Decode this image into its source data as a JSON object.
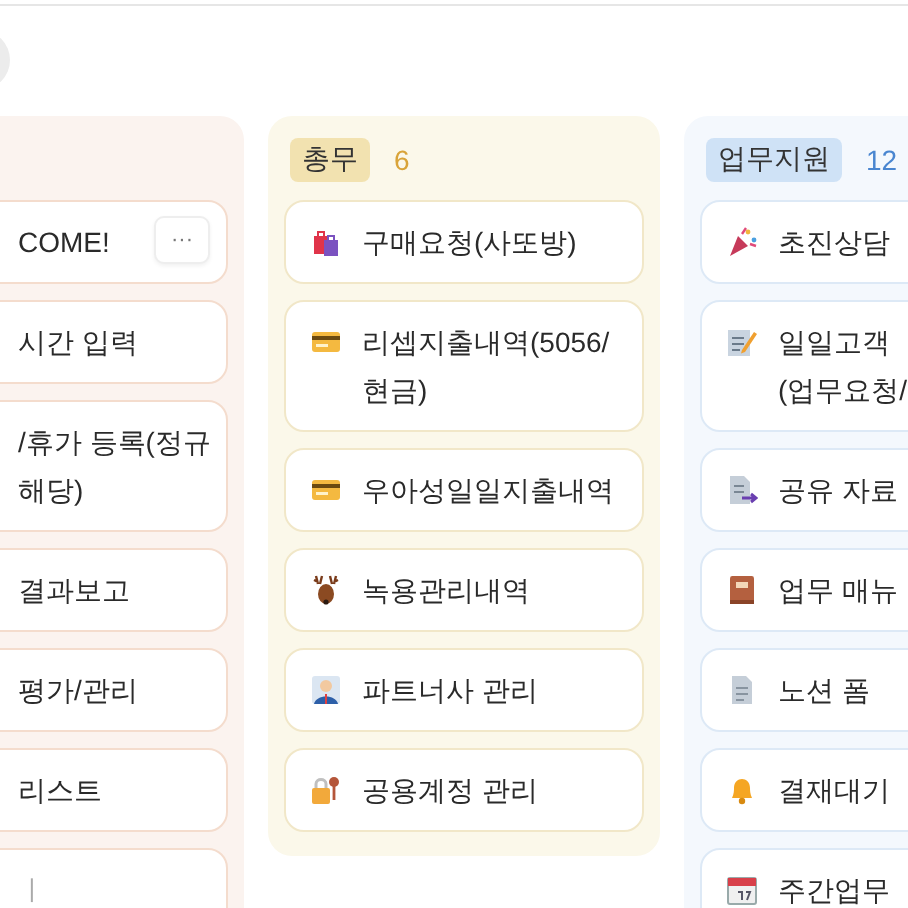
{
  "columns": [
    {
      "cards": [
        {
          "lines": [
            "COME!"
          ],
          "more": "···"
        },
        {
          "lines": [
            "시간 입력"
          ]
        },
        {
          "lines": [
            "/휴가 등록(정규",
            "해당)"
          ]
        },
        {
          "lines": [
            "결과보고"
          ]
        },
        {
          "lines": [
            "평가/관리"
          ]
        },
        {
          "lines": [
            "리스트"
          ]
        },
        {
          "lines": [
            "ㅣ"
          ],
          "muted": true
        }
      ]
    },
    {
      "tag": "총무",
      "count": "6",
      "color": "#d9a43a",
      "cards": [
        {
          "lines": [
            "구매요청(사또방)"
          ]
        },
        {
          "lines": [
            "리셉지출내역(5056/",
            "현금)"
          ]
        },
        {
          "lines": [
            "우아성일일지출내역"
          ]
        },
        {
          "lines": [
            "녹용관리내역"
          ]
        },
        {
          "lines": [
            "파트너사 관리"
          ]
        },
        {
          "lines": [
            "공용계정 관리"
          ]
        }
      ]
    },
    {
      "tag": "업무지원",
      "count": "12",
      "color": "#4a86d0",
      "cards": [
        {
          "lines": [
            "초진상담"
          ]
        },
        {
          "lines": [
            "일일고객",
            "(업무요청/"
          ]
        },
        {
          "lines": [
            "공유 자료"
          ]
        },
        {
          "lines": [
            "업무 매뉴"
          ]
        },
        {
          "lines": [
            "노션 폼"
          ]
        },
        {
          "lines": [
            "결재대기"
          ]
        },
        {
          "lines": [
            "주간업무"
          ]
        }
      ]
    }
  ]
}
